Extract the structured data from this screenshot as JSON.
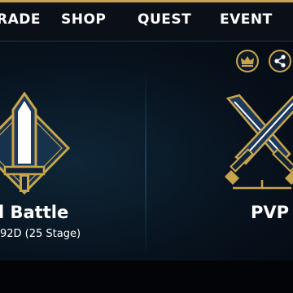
{
  "nav": {
    "items": [
      {
        "label": "RADE"
      },
      {
        "label": "SHOP"
      },
      {
        "label": "QUEST"
      },
      {
        "label": "EVENT"
      }
    ]
  },
  "top_actions": {
    "rank_icon": "crown-icon",
    "share_icon": "share-icon"
  },
  "modes": {
    "left": {
      "title": "l Battle",
      "subtitle": "92D (25 Stage)",
      "icon": "sword-icon"
    },
    "right": {
      "title": "PVP",
      "icon": "crossed-swords-icon"
    }
  },
  "colors": {
    "gold": "#c9a44c",
    "navy": "#1a3350",
    "background": "#08131f"
  }
}
